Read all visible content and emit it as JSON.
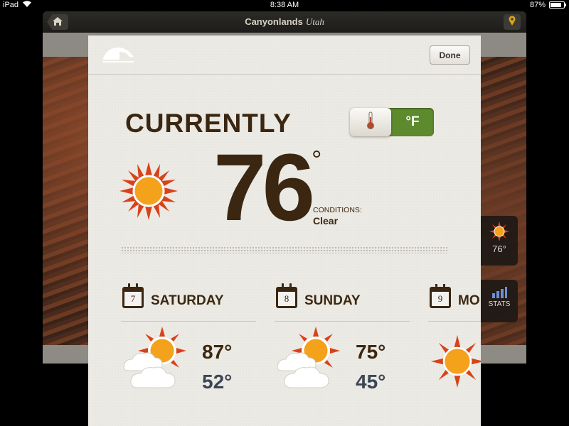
{
  "status_bar": {
    "device": "iPad",
    "time": "8:38 AM",
    "battery": "87%"
  },
  "navbar": {
    "title": "Canyonlands",
    "subtitle": "Utah"
  },
  "side_widgets": {
    "temp": "76°",
    "stats_label": "STATS"
  },
  "modal": {
    "done_label": "Done",
    "heading": "CURRENTLY",
    "unit_toggle": {
      "selected": "°F",
      "icon": "thermometer-icon"
    },
    "current_temp": "76",
    "degree_symbol": "°",
    "conditions_label": "CONDITIONS:",
    "conditions_value": "Clear"
  },
  "forecast": [
    {
      "date": "7",
      "day": "SATURDAY",
      "icon": "partly-cloudy-icon",
      "high": "87°",
      "low": "52°"
    },
    {
      "date": "8",
      "day": "SUNDAY",
      "icon": "partly-cloudy-icon",
      "high": "75°",
      "low": "45°"
    },
    {
      "date": "9",
      "day": "MO",
      "icon": "sun-icon"
    }
  ],
  "colors": {
    "accent_green": "#5d8a2d",
    "text_brown": "#3b2711",
    "sun_orange": "#f4a11c",
    "sun_red": "#d8421a"
  }
}
